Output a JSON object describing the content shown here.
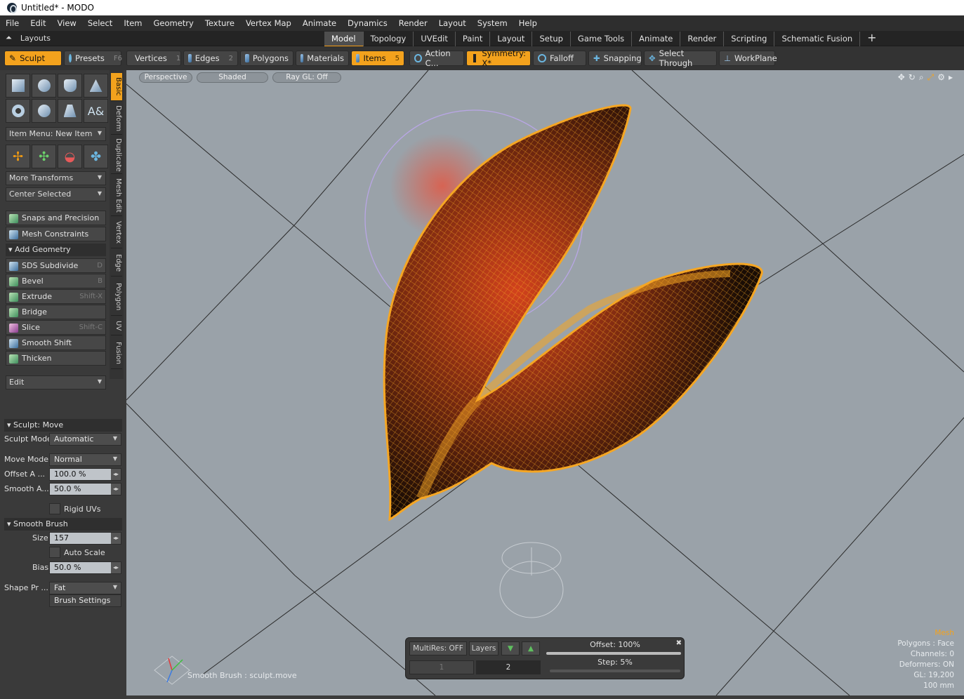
{
  "window": {
    "title": "Untitled* - MODO"
  },
  "menu": [
    "File",
    "Edit",
    "View",
    "Select",
    "Item",
    "Geometry",
    "Texture",
    "Vertex Map",
    "Animate",
    "Dynamics",
    "Render",
    "Layout",
    "System",
    "Help"
  ],
  "layouts": {
    "label": "Layouts",
    "tabs": [
      "Model",
      "Topology",
      "UVEdit",
      "Paint",
      "Layout",
      "Setup",
      "Game Tools",
      "Animate",
      "Render",
      "Scripting",
      "Schematic Fusion"
    ],
    "active": "Model",
    "plus": "+"
  },
  "toolbar": {
    "sculpt": "Sculpt",
    "presets": "Presets",
    "presets_key": "F6",
    "vertices": "Vertices",
    "vertices_key": "1",
    "edges": "Edges",
    "edges_key": "2",
    "polygons": "Polygons",
    "materials": "Materials",
    "items": "Items",
    "items_key": "5",
    "action_center": "Action C...",
    "symmetry": "Symmetry: X*",
    "falloff": "Falloff",
    "snapping": "Snapping",
    "select_through": "Select Through",
    "workplane": "WorkPlane"
  },
  "left": {
    "vtabs": [
      "Basic",
      "Deform",
      "Duplicate",
      "Mesh Edit",
      "Vertex",
      "Edge",
      "Polygon",
      "UV",
      "Fusion"
    ],
    "item_menu": "Item Menu: New Item",
    "more_transforms": "More Transforms",
    "center_selected": "Center Selected",
    "snaps": "Snaps and Precision",
    "constraints": "Mesh Constraints",
    "add_geometry": "Add Geometry",
    "geo": [
      {
        "label": "SDS Subdivide",
        "key": "D"
      },
      {
        "label": "Bevel",
        "key": "B"
      },
      {
        "label": "Extrude",
        "key": "Shift-X"
      },
      {
        "label": "Bridge",
        "key": ""
      },
      {
        "label": "Slice",
        "key": "Shift-C"
      },
      {
        "label": "Smooth Shift",
        "key": ""
      },
      {
        "label": "Thicken",
        "key": ""
      }
    ],
    "edit": "Edit"
  },
  "props": {
    "sculpt_move": "Sculpt: Move",
    "sculpt_mode_label": "Sculpt Mode",
    "sculpt_mode": "Automatic",
    "move_mode_label": "Move Mode",
    "move_mode": "Normal",
    "offset_label": "Offset A ...",
    "offset": "100.0 %",
    "smooth_label": "Smooth A...",
    "smooth": "50.0 %",
    "rigid_uvs": "Rigid UVs",
    "smooth_brush": "Smooth Brush",
    "size_label": "Size",
    "size": "157",
    "auto_scale": "Auto Scale",
    "bias_label": "Bias",
    "bias": "50.0 %",
    "shape_label": "Shape Pr ...",
    "shape": "Fat",
    "brush_settings": "Brush Settings"
  },
  "viewport": {
    "perspective": "Perspective",
    "shaded": "Shaded",
    "raygl": "Ray GL: Off",
    "hint": "Smooth Brush : sculpt.move",
    "stats": [
      "Mesh",
      "Polygons : Face",
      "Channels: 0",
      "Deformers: ON",
      "GL: 19,200",
      "100 mm"
    ]
  },
  "multires": {
    "state": "MultiRes: OFF",
    "layers": "Layers",
    "offset": "Offset: 100%",
    "step": "Step:  5%",
    "level1": "1",
    "level2": "2"
  },
  "colors": {
    "accent": "#f3a21d",
    "viewport_bg": "#9aa2a9"
  }
}
